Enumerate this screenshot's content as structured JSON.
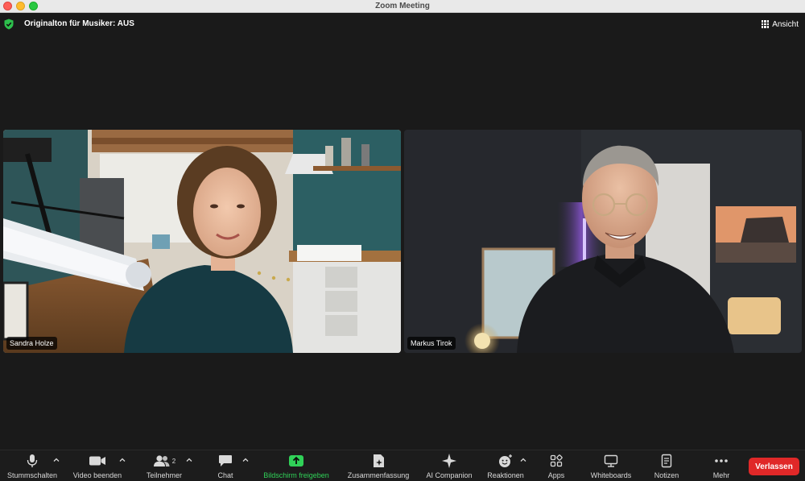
{
  "window": {
    "title": "Zoom Meeting"
  },
  "topbar": {
    "original_audio": "Originalton für Musiker: AUS",
    "view_label": "Ansicht"
  },
  "participants": [
    {
      "name": "Sandra Holze"
    },
    {
      "name": "Markus Tirok"
    }
  ],
  "toolbar": {
    "mute": "Stummschalten",
    "stop_video": "Video beenden",
    "participants": "Teilnehmer",
    "participants_count": "2",
    "chat": "Chat",
    "share_screen": "Bildschirm freigeben",
    "summary": "Zusammenfassung",
    "ai_companion": "AI Companion",
    "reactions": "Reaktionen",
    "apps": "Apps",
    "whiteboards": "Whiteboards",
    "notes": "Notizen",
    "more": "Mehr",
    "leave": "Verlassen"
  },
  "colors": {
    "share_green": "#30d158",
    "leave_red": "#e02828",
    "shield_green": "#2dbf4c"
  }
}
